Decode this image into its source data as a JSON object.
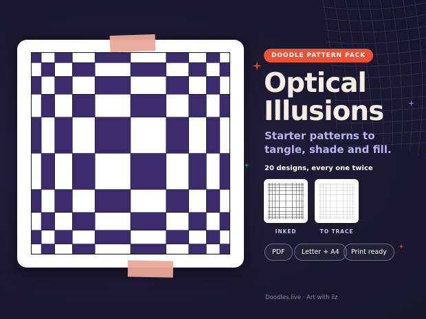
{
  "badge": "DOODLE PATTERN PACK",
  "title": {
    "line1": "Optical",
    "line2": "Illusions"
  },
  "subtitle": "Starter patterns to tangle, shade and fill.",
  "count_text": "20 designs, every one twice",
  "thumbnails": [
    {
      "label": "INKED"
    },
    {
      "label": "TO TRACE"
    }
  ],
  "chips": [
    "PDF",
    "Letter + A4",
    "Print ready"
  ],
  "footer": "Doodles.live · Art with ilz",
  "colors": {
    "background": "#1d1a33",
    "badge": "#ea5237",
    "title": "#f4ede2",
    "subtitle": "#b9b2ec",
    "checker_dark": "#3c2b6c",
    "tape": "#e8a898"
  },
  "icons": [
    "sparkle-icon"
  ]
}
